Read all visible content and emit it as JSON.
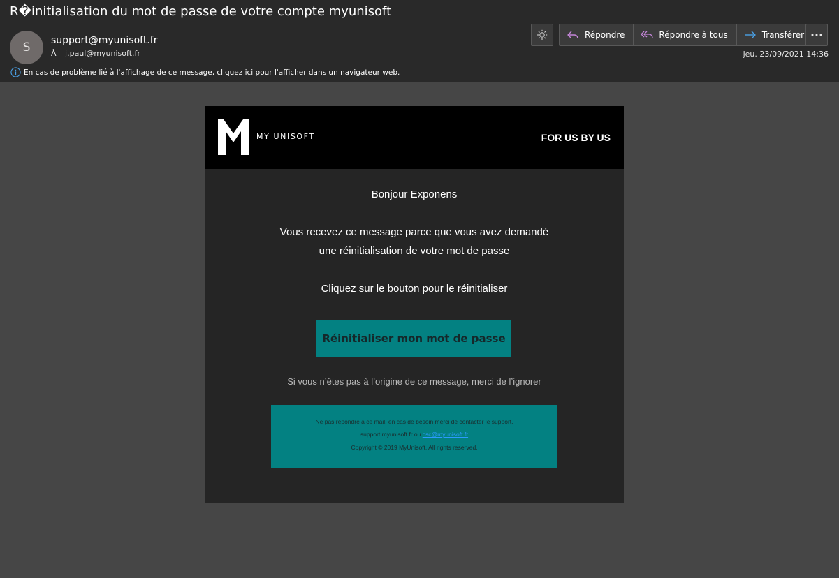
{
  "header": {
    "subject": "R�initialisation du mot de passe de votre compte myunisoft",
    "avatar_initial": "S",
    "sender": "support@myunisoft.fr",
    "to_label": "À",
    "to_address": "j.paul@myunisoft.fr",
    "date": "jeu. 23/09/2021 14:36",
    "info_text": "En cas de problème lié à l'affichage de ce message, cliquez ici pour l'afficher dans un navigateur web.",
    "actions": {
      "reply": "Répondre",
      "reply_all": "Répondre à tous",
      "forward": "Transférer"
    },
    "icons": {
      "theme": "sun-icon",
      "reply": "reply-icon",
      "reply_all": "reply-all-icon",
      "forward": "forward-arrow-icon",
      "more": "more-icon",
      "info": "info-icon"
    },
    "colors": {
      "reply_icon": "#c586d9",
      "forward_icon": "#4aa0e6",
      "info_icon": "#4aa0e6"
    }
  },
  "email": {
    "brand": "MY UNISOFT",
    "slogan": "FOR US BY US",
    "greeting": "Bonjour Exponens",
    "message_line1": "Vous recevez ce message parce que vous avez demandé",
    "message_line2": "une réinitialisation de votre mot de passe",
    "instruction": "Cliquez sur le bouton pour le réinitialiser",
    "button_label": "Réinitialiser mon mot de passe",
    "ignore_note": "Si vous n’êtes pas à l’origine de ce message, merci de l’ignorer",
    "footer": {
      "line1": "Ne pas répondre à ce mail, en cas de besoin merci de contacter le support.",
      "line2_prefix": "support.myunisoft.fr ou ",
      "line2_link": "csc@myunisoft.fr",
      "line3": "Copyright © 2019 MyUnisoft. All rights reserved."
    },
    "colors": {
      "accent": "#038182",
      "header_bg": "#000000",
      "body_bg": "#252525"
    }
  }
}
